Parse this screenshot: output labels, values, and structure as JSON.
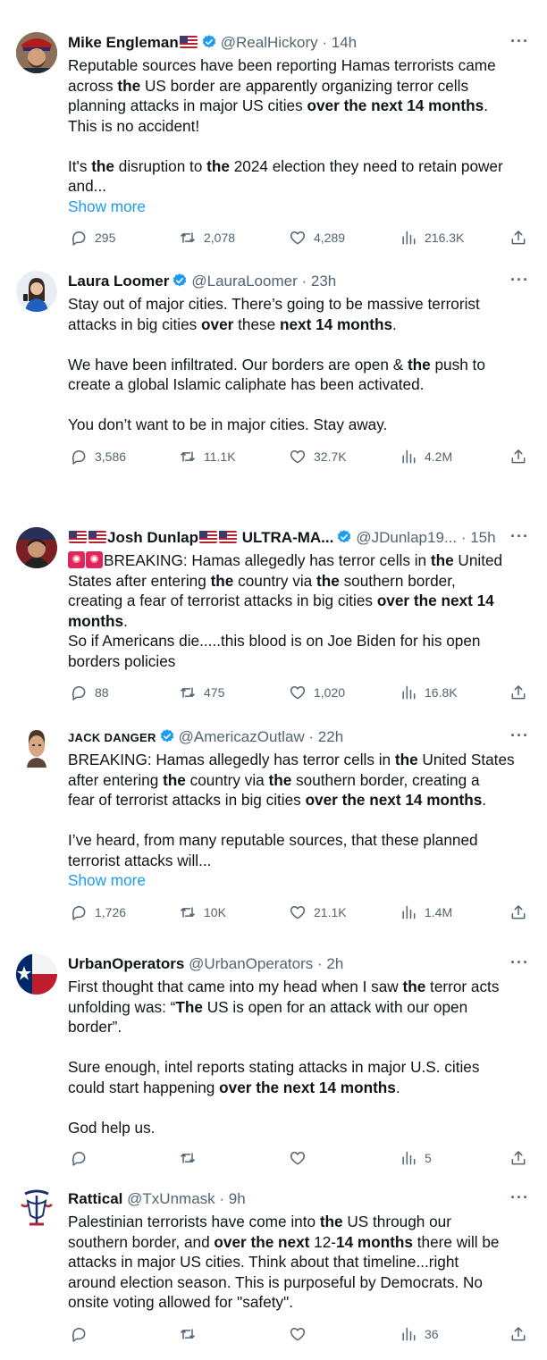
{
  "icons": {
    "reply": "comment-bubble-icon",
    "retweet": "retweet-icon",
    "like": "heart-icon",
    "views": "bar-chart-icon",
    "share": "share-icon",
    "more": "more-dots-icon",
    "verified": "verified-badge-icon"
  },
  "colors": {
    "link": "#1d9bf0",
    "secondary": "#536471",
    "verified": "#1d9bf0"
  },
  "tweets": [
    {
      "name": "Mike Engleman",
      "handle": "@RealHickory",
      "time": "· 14h",
      "lines": [
        "Reputable sources have been reporting Hamas terrorists came",
        "across the US border are apparently organizing terror cells",
        "planning attacks in major US cities over the next 14 months.",
        "This is no accident!",
        "",
        "It's the disruption to the 2024 election they need to retain power",
        "and..."
      ],
      "show_more": "Show more",
      "replies": "295",
      "retweets": "2,078",
      "likes": "4,289",
      "views": "216.3K"
    },
    {
      "name": "Laura Loomer",
      "handle": "@LauraLoomer",
      "time": "· 23h",
      "lines": [
        "Stay out of major cities. There’s going to be massive terrorist",
        "attacks in big cities over these next 14 months.",
        "",
        "We have been infiltrated. Our borders are open & the push to",
        "create a global Islamic caliphate has been activated.",
        "",
        "You don’t want to be in major cities. Stay away."
      ],
      "replies": "3,586",
      "retweets": "11.1K",
      "likes": "32.7K",
      "views": "4.2M"
    },
    {
      "name": "Josh Dunlap",
      "name_suffix": "ULTRA-MA...",
      "handle": "@JDunlap19...",
      "time": "· 15h",
      "lines": [
        "BREAKING: Hamas allegedly has terror cells in the United",
        "States after entering the country via the southern border,",
        "creating a fear of terrorist attacks in big cities over the next 14",
        "months.",
        "So if Americans die.....this blood is on Joe Biden for his open",
        "borders policies"
      ],
      "replies": "88",
      "retweets": "475",
      "likes": "1,020",
      "views": "16.8K"
    },
    {
      "name": "JACK DANGER",
      "handle": "@AmericazOutlaw",
      "time": "· 22h",
      "lines": [
        "BREAKING: Hamas allegedly has terror cells in the United States",
        "after entering the country via the southern border, creating a",
        "fear of terrorist attacks in big cities over the next 14 months.",
        "",
        "I’ve heard, from many reputable sources, that these planned",
        "terrorist attacks will..."
      ],
      "show_more": "Show more",
      "replies": "1,726",
      "retweets": "10K",
      "likes": "21.1K",
      "views": "1.4M"
    },
    {
      "name": "UrbanOperators",
      "handle": "@UrbanOperators",
      "time": "· 2h",
      "lines": [
        "First thought that came into my head when I saw the terror acts",
        "unfolding was: “The US is open for an attack with our open",
        "border”.",
        "",
        "Sure enough, intel reports stating attacks in major U.S. cities",
        "could start happening over the next 14 months.",
        "",
        "God help us."
      ],
      "replies": "",
      "retweets": "",
      "likes": "",
      "views": "5"
    },
    {
      "name": "Rattical",
      "handle": "@TxUnmask",
      "time": "· 9h",
      "lines": [
        "Palestinian terrorists have come into the US through our",
        "southern border, and over the next 12-14 months there will be",
        "attacks in major US cities. Think about that timeline...right",
        "around election season.  This is purposeful by Democrats. No",
        "onsite voting allowed for \"safety\"."
      ],
      "replies": "",
      "retweets": "",
      "likes": "",
      "views": "36"
    }
  ]
}
